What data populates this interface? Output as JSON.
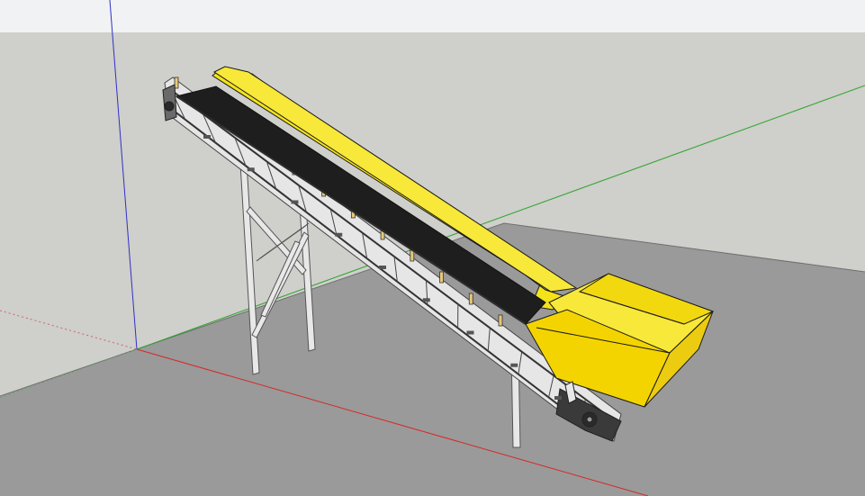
{
  "app": {
    "name": ""
  },
  "scene": {
    "model": "inclined-belt-conveyor-with-hopper",
    "colors": {
      "sky": "#f1f2f3",
      "ground_far": "#cfcfcb",
      "ground_plane": "#9a9a9a",
      "belt": "#1e1e1e",
      "belt_edge": "#2d2d2d",
      "skirt": "#f5e31a",
      "skirt_shadow": "#e3cf10",
      "hopper_top": "#f7e83a",
      "hopper_side": "#eccc10",
      "hopper_front": "#f4d400",
      "frame": "#e8e8e8",
      "frame_edge": "#555555",
      "axis_red": "#d62828",
      "axis_green": "#2fa52f",
      "axis_blue": "#3030c8",
      "outline": "#1a1a1a"
    },
    "axes": [
      {
        "name": "red-axis",
        "color_key": "axis_red"
      },
      {
        "name": "green-axis",
        "color_key": "axis_green"
      },
      {
        "name": "blue-axis",
        "color_key": "axis_blue"
      }
    ]
  }
}
